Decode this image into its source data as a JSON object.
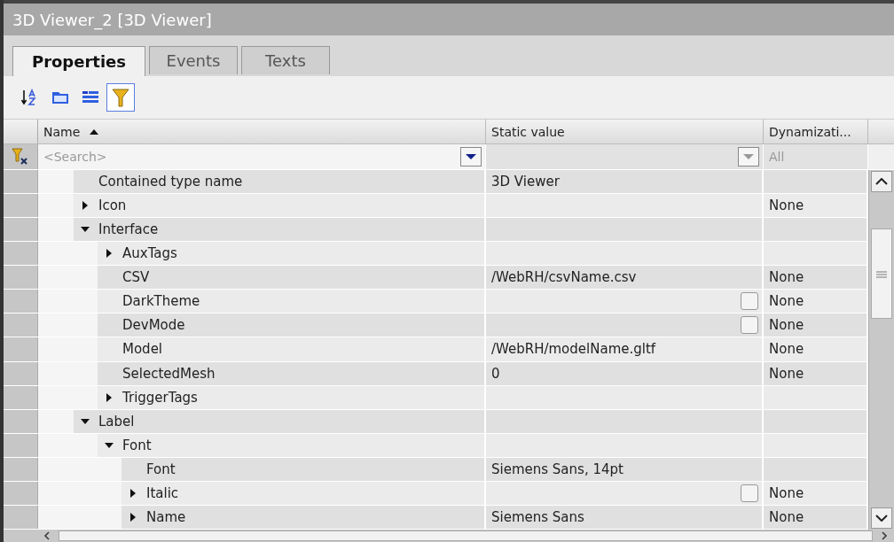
{
  "window": {
    "title": "3D Viewer_2 [3D Viewer]"
  },
  "tabs": [
    {
      "label": "Properties",
      "selected": true
    },
    {
      "label": "Events",
      "selected": false
    },
    {
      "label": "Texts",
      "selected": false
    }
  ],
  "toolbar": [
    {
      "kind": "sort",
      "on": false
    },
    {
      "kind": "group",
      "on": false
    },
    {
      "kind": "list",
      "on": false
    },
    {
      "kind": "filter",
      "on": true
    }
  ],
  "table": {
    "columns": [
      {
        "label": "Name",
        "sorted": true
      },
      {
        "label": "Static value",
        "sorted": false
      },
      {
        "label": "Dynamizati...",
        "sorted": false
      }
    ],
    "filter": {
      "placeholder": "<Search>",
      "dynamization": "All"
    },
    "rows": [
      {
        "name": "Contained type name",
        "value": "3D Viewer"
      },
      {
        "name": "Icon",
        "expanded": false,
        "dynamization": "None"
      },
      {
        "name": "Interface",
        "expanded": true,
        "children": [
          {
            "name": "AuxTags",
            "expanded": false
          },
          {
            "name": "CSV",
            "value": "/WebRH/csvName.csv",
            "dynamization": "None"
          },
          {
            "name": "DarkTheme",
            "kind": "checkbox",
            "checked": false,
            "dynamization": "None"
          },
          {
            "name": "DevMode",
            "kind": "checkbox",
            "checked": false,
            "dynamization": "None"
          },
          {
            "name": "Model",
            "value": "/WebRH/modelName.gltf",
            "dynamization": "None"
          },
          {
            "name": "SelectedMesh",
            "value": "0",
            "dynamization": "None"
          },
          {
            "name": "TriggerTags",
            "expanded": false
          }
        ]
      },
      {
        "name": "Label",
        "expanded": true,
        "children": [
          {
            "name": "Font",
            "expanded": true,
            "children": [
              {
                "name": "Font",
                "value": "Siemens Sans, 14pt"
              },
              {
                "name": "Italic",
                "expanded": false,
                "kind": "checkbox",
                "checked": false,
                "dynamization": "None"
              },
              {
                "name": "Name",
                "expanded": false,
                "value": "Siemens Sans",
                "dynamization": "None"
              }
            ]
          }
        ]
      }
    ]
  }
}
